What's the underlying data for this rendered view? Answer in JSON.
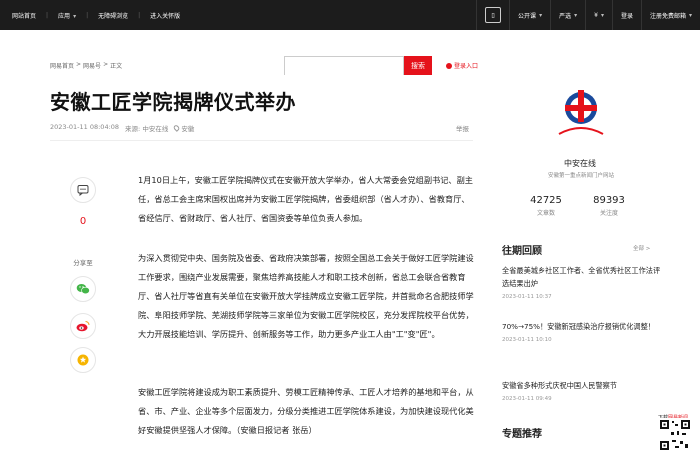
{
  "topbar": {
    "left_items": [
      "网站首页",
      "应用",
      "无障碍浏览",
      "进入关怀版"
    ],
    "right_items": {
      "phone_icon": "phone-icon",
      "public_class": "公开课",
      "strict": "严选",
      "currency": "¥",
      "login": "登录",
      "free_mail": "注册免费邮箱"
    }
  },
  "breadcrumb": [
    "网易首页",
    ">",
    "网易号",
    ">",
    "正文"
  ],
  "search": {
    "placeholder": "",
    "button": "搜索"
  },
  "login_tip": "登录入口",
  "article": {
    "title": "安徽工匠学院揭牌仪式举办",
    "datetime": "2023-01-11 08:04:08",
    "source_prefix": "来源:",
    "source": "中安在线",
    "location": "安徽",
    "report": "举报",
    "paragraphs": [
      "1月10日上午，安徽工匠学院揭牌仪式在安徽开放大学举办，省人大常委会党组副书记、副主任，省总工会主席宋国权出席并为安徽工匠学院揭牌，省委组织部（省人才办）、省教育厅、省经信厅、省财政厅、省人社厅、省国资委等单位负责人参加。",
      "为深入贯彻党中央、国务院及省委、省政府决策部署，按照全国总工会关于做好工匠学院建设工作要求，围绕产业发展需要，聚焦培养高技能人才和职工技术创新，省总工会联合省教育厅、省人社厅等省直有关单位在安徽开放大学挂牌成立安徽工匠学院，并首批命名合肥技师学院、阜阳技师学院、芜湖技师学院等三家单位为安徽工匠学院校区，充分发挥院校平台优势，大力开展技能培训、学历提升、创新服务等工作，助力更多产业工人由\"工\"变\"匠\"。",
      "安徽工匠学院将建设成为职工素质提升、劳模工匠精神传承、工匠人才培养的基地和平台，从省、市、产业、企业等多个层面发力，分级分类推进工匠学院体系建设，为加快建设现代化美好安徽提供坚强人才保障。（安徽日报记者 张岳）"
    ]
  },
  "side_share": {
    "comment_count": "0",
    "share_label": "分享至",
    "icons": [
      "comment-icon",
      "wechat-icon",
      "weibo-icon",
      "favorite-icon"
    ]
  },
  "author": {
    "logo_text": "中安在线",
    "name": "中安在线",
    "desc": "安徽第一重点新闻门户网站",
    "articles": "42725",
    "articles_label": "文章数",
    "followers": "89393",
    "followers_label": "关注度"
  },
  "past_reviews": {
    "title": "往期回顾",
    "more": "全部 >",
    "items": [
      {
        "headline": "全省最美城乡社区工作者、全省优秀社区工作法评选结果出炉",
        "time": "2023-01-11 10:37"
      },
      {
        "headline": "70%→75%！安徽新冠感染治疗报销优化调整！",
        "time": "2023-01-11 10:10"
      },
      {
        "headline": "安徽省多种形式庆祝中国人民警察节",
        "time": "2023-01-11 09:49"
      }
    ]
  },
  "topic": {
    "title": "专题推荐"
  },
  "qr": {
    "label_prefix": "下载",
    "label_highlight": "网易新闻"
  }
}
